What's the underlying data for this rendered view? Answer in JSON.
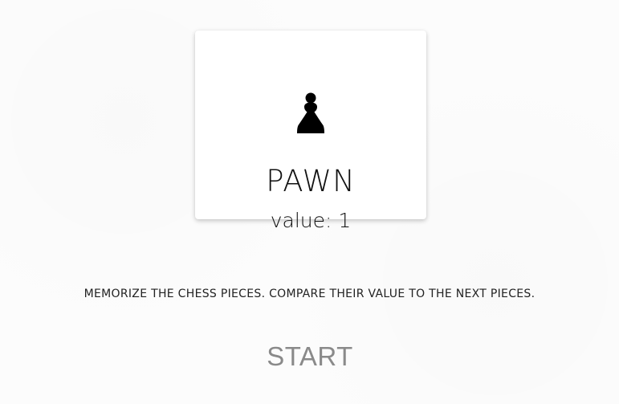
{
  "card": {
    "piece_icon": "pawn-icon",
    "piece_name": "PAWN",
    "piece_value": "value: 1"
  },
  "instructions": "MEMORIZE THE CHESS PIECES. COMPARE THEIR VALUE TO THE NEXT PIECES.",
  "start_button": "START",
  "colors": {
    "background": "#fcfcfc",
    "card": "#ffffff",
    "text": "#111111",
    "start_text": "#8a8a8a"
  }
}
